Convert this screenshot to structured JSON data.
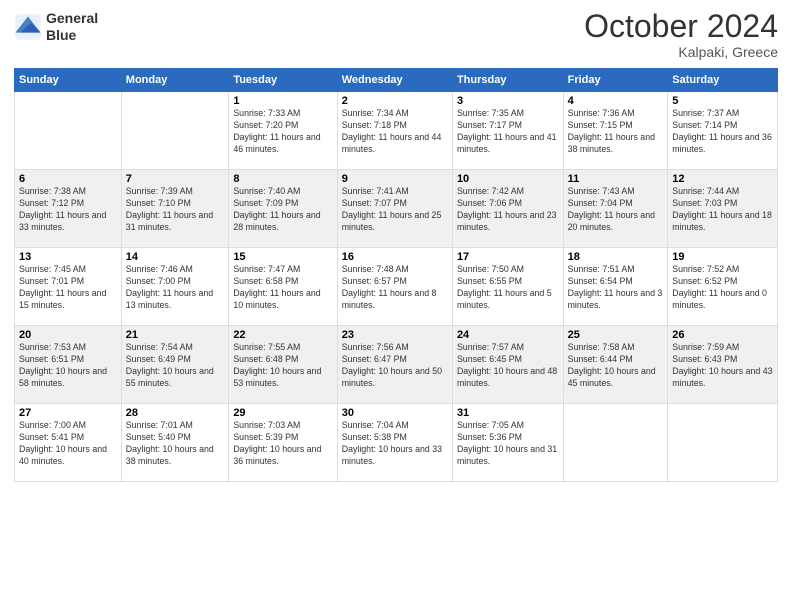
{
  "header": {
    "logo_line1": "General",
    "logo_line2": "Blue",
    "month": "October 2024",
    "location": "Kalpaki, Greece"
  },
  "weekdays": [
    "Sunday",
    "Monday",
    "Tuesday",
    "Wednesday",
    "Thursday",
    "Friday",
    "Saturday"
  ],
  "weeks": [
    [
      {
        "day": "",
        "info": ""
      },
      {
        "day": "",
        "info": ""
      },
      {
        "day": "1",
        "info": "Sunrise: 7:33 AM\nSunset: 7:20 PM\nDaylight: 11 hours and 46 minutes."
      },
      {
        "day": "2",
        "info": "Sunrise: 7:34 AM\nSunset: 7:18 PM\nDaylight: 11 hours and 44 minutes."
      },
      {
        "day": "3",
        "info": "Sunrise: 7:35 AM\nSunset: 7:17 PM\nDaylight: 11 hours and 41 minutes."
      },
      {
        "day": "4",
        "info": "Sunrise: 7:36 AM\nSunset: 7:15 PM\nDaylight: 11 hours and 38 minutes."
      },
      {
        "day": "5",
        "info": "Sunrise: 7:37 AM\nSunset: 7:14 PM\nDaylight: 11 hours and 36 minutes."
      }
    ],
    [
      {
        "day": "6",
        "info": "Sunrise: 7:38 AM\nSunset: 7:12 PM\nDaylight: 11 hours and 33 minutes."
      },
      {
        "day": "7",
        "info": "Sunrise: 7:39 AM\nSunset: 7:10 PM\nDaylight: 11 hours and 31 minutes."
      },
      {
        "day": "8",
        "info": "Sunrise: 7:40 AM\nSunset: 7:09 PM\nDaylight: 11 hours and 28 minutes."
      },
      {
        "day": "9",
        "info": "Sunrise: 7:41 AM\nSunset: 7:07 PM\nDaylight: 11 hours and 25 minutes."
      },
      {
        "day": "10",
        "info": "Sunrise: 7:42 AM\nSunset: 7:06 PM\nDaylight: 11 hours and 23 minutes."
      },
      {
        "day": "11",
        "info": "Sunrise: 7:43 AM\nSunset: 7:04 PM\nDaylight: 11 hours and 20 minutes."
      },
      {
        "day": "12",
        "info": "Sunrise: 7:44 AM\nSunset: 7:03 PM\nDaylight: 11 hours and 18 minutes."
      }
    ],
    [
      {
        "day": "13",
        "info": "Sunrise: 7:45 AM\nSunset: 7:01 PM\nDaylight: 11 hours and 15 minutes."
      },
      {
        "day": "14",
        "info": "Sunrise: 7:46 AM\nSunset: 7:00 PM\nDaylight: 11 hours and 13 minutes."
      },
      {
        "day": "15",
        "info": "Sunrise: 7:47 AM\nSunset: 6:58 PM\nDaylight: 11 hours and 10 minutes."
      },
      {
        "day": "16",
        "info": "Sunrise: 7:48 AM\nSunset: 6:57 PM\nDaylight: 11 hours and 8 minutes."
      },
      {
        "day": "17",
        "info": "Sunrise: 7:50 AM\nSunset: 6:55 PM\nDaylight: 11 hours and 5 minutes."
      },
      {
        "day": "18",
        "info": "Sunrise: 7:51 AM\nSunset: 6:54 PM\nDaylight: 11 hours and 3 minutes."
      },
      {
        "day": "19",
        "info": "Sunrise: 7:52 AM\nSunset: 6:52 PM\nDaylight: 11 hours and 0 minutes."
      }
    ],
    [
      {
        "day": "20",
        "info": "Sunrise: 7:53 AM\nSunset: 6:51 PM\nDaylight: 10 hours and 58 minutes."
      },
      {
        "day": "21",
        "info": "Sunrise: 7:54 AM\nSunset: 6:49 PM\nDaylight: 10 hours and 55 minutes."
      },
      {
        "day": "22",
        "info": "Sunrise: 7:55 AM\nSunset: 6:48 PM\nDaylight: 10 hours and 53 minutes."
      },
      {
        "day": "23",
        "info": "Sunrise: 7:56 AM\nSunset: 6:47 PM\nDaylight: 10 hours and 50 minutes."
      },
      {
        "day": "24",
        "info": "Sunrise: 7:57 AM\nSunset: 6:45 PM\nDaylight: 10 hours and 48 minutes."
      },
      {
        "day": "25",
        "info": "Sunrise: 7:58 AM\nSunset: 6:44 PM\nDaylight: 10 hours and 45 minutes."
      },
      {
        "day": "26",
        "info": "Sunrise: 7:59 AM\nSunset: 6:43 PM\nDaylight: 10 hours and 43 minutes."
      }
    ],
    [
      {
        "day": "27",
        "info": "Sunrise: 7:00 AM\nSunset: 5:41 PM\nDaylight: 10 hours and 40 minutes."
      },
      {
        "day": "28",
        "info": "Sunrise: 7:01 AM\nSunset: 5:40 PM\nDaylight: 10 hours and 38 minutes."
      },
      {
        "day": "29",
        "info": "Sunrise: 7:03 AM\nSunset: 5:39 PM\nDaylight: 10 hours and 36 minutes."
      },
      {
        "day": "30",
        "info": "Sunrise: 7:04 AM\nSunset: 5:38 PM\nDaylight: 10 hours and 33 minutes."
      },
      {
        "day": "31",
        "info": "Sunrise: 7:05 AM\nSunset: 5:36 PM\nDaylight: 10 hours and 31 minutes."
      },
      {
        "day": "",
        "info": ""
      },
      {
        "day": "",
        "info": ""
      }
    ]
  ]
}
